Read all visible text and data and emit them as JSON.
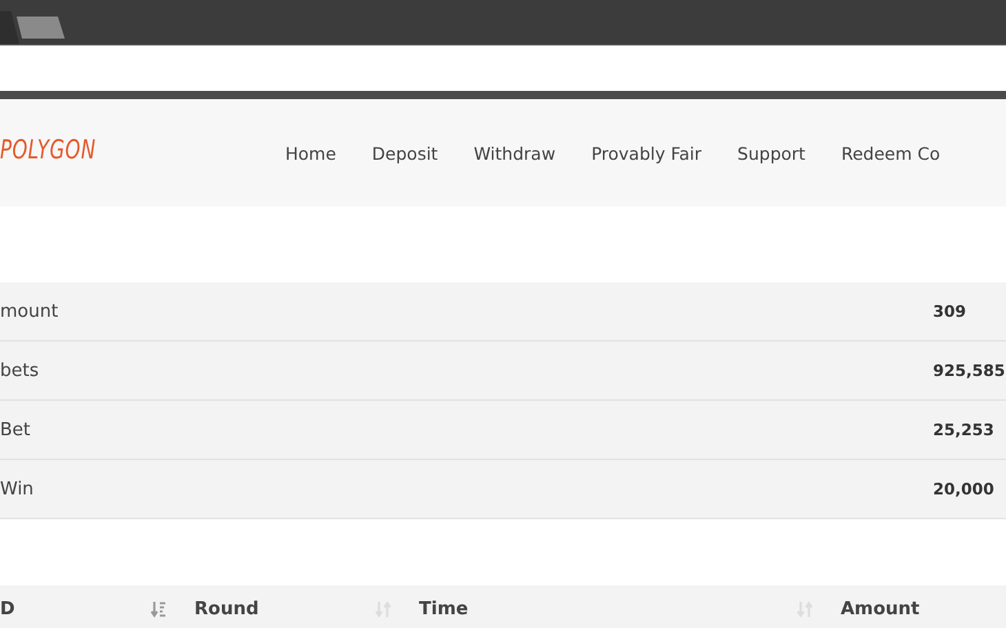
{
  "logo": "POLYGON",
  "nav": [
    {
      "label": "Home"
    },
    {
      "label": "Deposit"
    },
    {
      "label": "Withdraw"
    },
    {
      "label": "Provably Fair"
    },
    {
      "label": "Support"
    },
    {
      "label": "Redeem Co"
    }
  ],
  "stats": [
    {
      "label": "mount",
      "value": "309"
    },
    {
      "label": "bets",
      "value": "925,585"
    },
    {
      "label": "Bet",
      "value": "25,253"
    },
    {
      "label": "Win",
      "value": "20,000"
    }
  ],
  "table": {
    "columns": [
      {
        "label": "D",
        "sorted": true
      },
      {
        "label": "Round",
        "sorted": false
      },
      {
        "label": "Time",
        "sorted": false
      },
      {
        "label": "Amount"
      }
    ]
  }
}
